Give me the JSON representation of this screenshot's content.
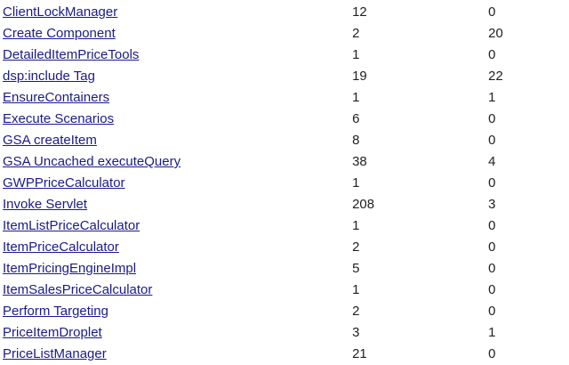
{
  "rows": [
    {
      "name": "ClientLockManager",
      "count": "12",
      "second": "0"
    },
    {
      "name": "Create Component",
      "count": "2",
      "second": "20"
    },
    {
      "name": "DetailedItemPriceTools",
      "count": "1",
      "second": "0"
    },
    {
      "name": "dsp:include Tag",
      "count": "19",
      "second": "22"
    },
    {
      "name": "EnsureContainers",
      "count": "1",
      "second": "1"
    },
    {
      "name": "Execute Scenarios",
      "count": "6",
      "second": "0"
    },
    {
      "name": "GSA createItem",
      "count": "8",
      "second": "0"
    },
    {
      "name": "GSA Uncached executeQuery",
      "count": "38",
      "second": "4"
    },
    {
      "name": "GWPPriceCalculator",
      "count": "1",
      "second": "0"
    },
    {
      "name": "Invoke Servlet",
      "count": "208",
      "second": "3"
    },
    {
      "name": "ItemListPriceCalculator",
      "count": "1",
      "second": "0"
    },
    {
      "name": "ItemPriceCalculator",
      "count": "2",
      "second": "0"
    },
    {
      "name": "ItemPricingEngineImpl",
      "count": "5",
      "second": "0"
    },
    {
      "name": "ItemSalesPriceCalculator",
      "count": "1",
      "second": "0"
    },
    {
      "name": "Perform Targeting",
      "count": "2",
      "second": "0"
    },
    {
      "name": "PriceItemDroplet",
      "count": "3",
      "second": "1"
    },
    {
      "name": "PriceListManager",
      "count": "21",
      "second": "0"
    }
  ],
  "colors": {
    "link": "#1a1a8c",
    "text": "#222222",
    "background": "#ffffff"
  }
}
